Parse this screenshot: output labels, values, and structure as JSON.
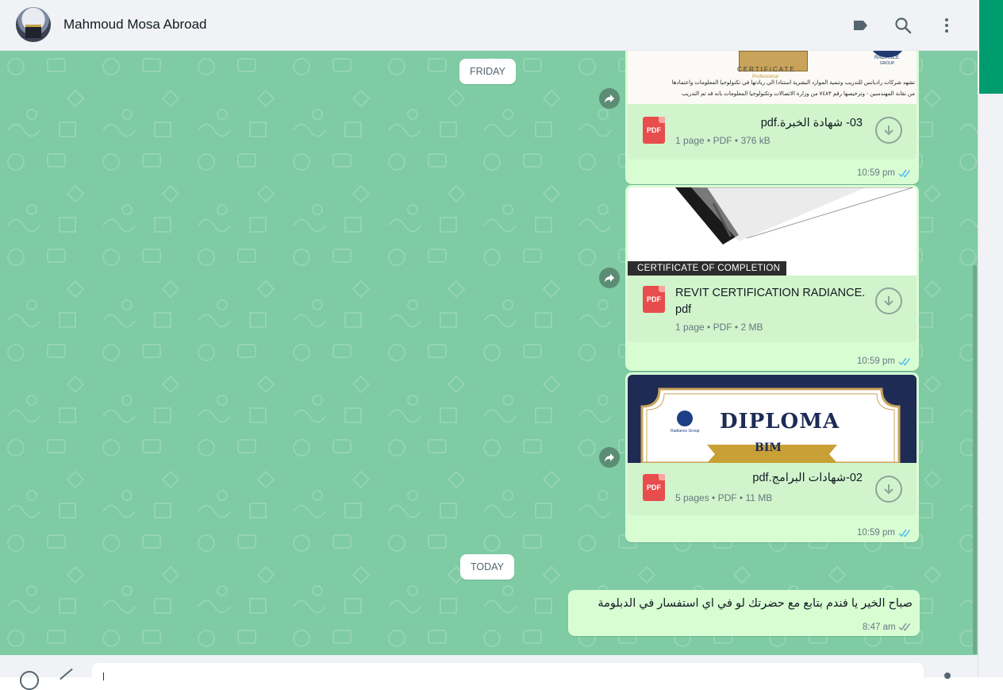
{
  "header": {
    "contact_name": "Mahmoud Mosa Abroad",
    "icons": [
      "label-icon",
      "search-icon",
      "menu-icon"
    ]
  },
  "dates": {
    "friday": "FRIDAY",
    "today": "TODAY"
  },
  "messages": [
    {
      "type": "document",
      "title": "03- شهادة الخبرة.pdf",
      "meta": "1 page • PDF • 376 kB",
      "time": "10:59 pm",
      "badge": "PDF",
      "thumb_texts": {
        "cert": "CERTIFICATE",
        "prof": "Professional",
        "brand": "RADIANCE",
        "group": "GROUP",
        "line1": "تشهد شركات راديانس للتدريب وتنمية الموارد البشرية استنادا الي ريادتها في تكنولوجيا المعلومات واعتمادها",
        "line2": "من نقابة المهندسين - وترخيصها رقم ٧٤٨٣ من وزارة الاتصالات وتكنولوجيا المعلومات بانه قد تم التدريب"
      }
    },
    {
      "type": "document",
      "title": "REVIT CERTIFICATION RADIANCE.pdf",
      "title_line1": "REVIT CERTIFICATION RADIANCE.",
      "title_line2": "pdf",
      "meta": "1 page • PDF • 2 MB",
      "time": "10:59 pm",
      "badge": "PDF",
      "thumb_caption": "CERTIFICATE OF COMPLETION"
    },
    {
      "type": "document",
      "title": "02-شهادات البرامج.pdf",
      "meta": "5 pages • PDF • 11 MB",
      "time": "10:59 pm",
      "badge": "PDF",
      "thumb_texts": {
        "heading": "DIPLOMA",
        "ribbon": "BIM",
        "logo_text": "Radiance Group"
      }
    },
    {
      "type": "text",
      "text": "صباح الخير يا فندم بتابع مع حضرتك لو في اي استفسار في الدبلومة",
      "time": "8:47 am"
    }
  ],
  "colors": {
    "chat_bg": "#7ecba4",
    "bubble_out": "#d9fdd3",
    "read_tick": "#53bdeb",
    "pdf_red": "#e84d4d"
  }
}
